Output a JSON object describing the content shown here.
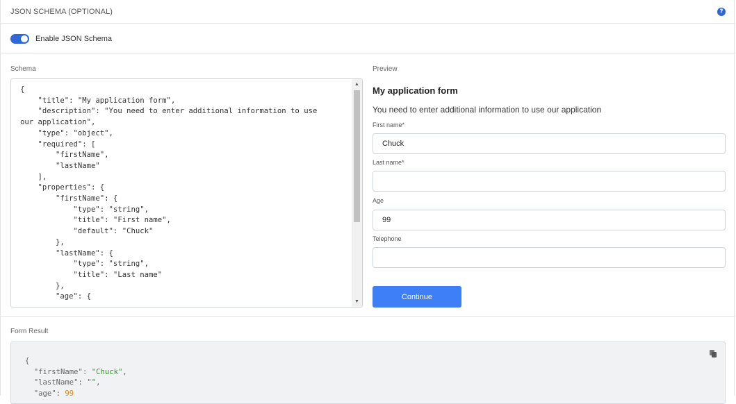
{
  "header": {
    "title": "JSON SCHEMA (OPTIONAL)"
  },
  "toggle": {
    "label": "Enable JSON Schema",
    "enabled": true
  },
  "schema": {
    "label": "Schema",
    "code": "{\n    \"title\": \"My application form\",\n    \"description\": \"You need to enter additional information to use\nour application\",\n    \"type\": \"object\",\n    \"required\": [\n        \"firstName\",\n        \"lastName\"\n    ],\n    \"properties\": {\n        \"firstName\": {\n            \"type\": \"string\",\n            \"title\": \"First name\",\n            \"default\": \"Chuck\"\n        },\n        \"lastName\": {\n            \"type\": \"string\",\n            \"title\": \"Last name\"\n        },\n        \"age\": {"
  },
  "preview": {
    "label": "Preview",
    "title": "My application form",
    "description": "You need to enter additional information to use our application",
    "fields": [
      {
        "label": "First name*",
        "value": "Chuck"
      },
      {
        "label": "Last name*",
        "value": ""
      },
      {
        "label": "Age",
        "value": "99"
      },
      {
        "label": "Telephone",
        "value": ""
      }
    ],
    "submit_label": "Continue"
  },
  "result": {
    "label": "Form Result",
    "open": "{",
    "lines": [
      {
        "key": "\"firstName\"",
        "value": "\"Chuck\"",
        "kind": "str",
        "suffix": ","
      },
      {
        "key": "\"lastName\"",
        "value": "\"\"",
        "kind": "str",
        "suffix": ","
      },
      {
        "key": "\"age\"",
        "value": "99",
        "kind": "num",
        "suffix": ""
      }
    ]
  },
  "colors": {
    "accent": "#2f66d8",
    "button": "#3e7ef7",
    "string": "#2a9a2a",
    "number": "#d98a1f"
  },
  "icons": {
    "help": "question-circle-icon",
    "copy": "copy-icon"
  }
}
